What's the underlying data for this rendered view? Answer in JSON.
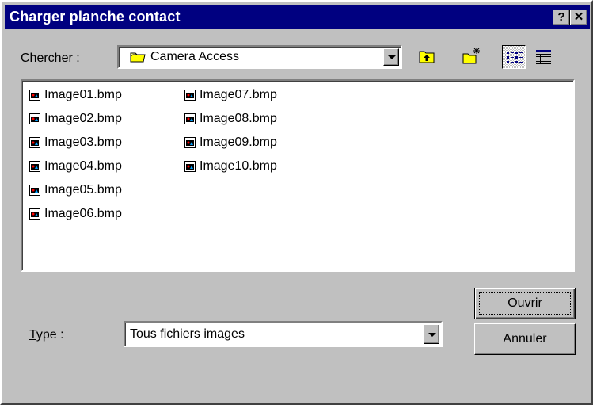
{
  "window": {
    "title": "Charger planche contact",
    "help_label": "?",
    "close_label": "✕"
  },
  "lookin": {
    "label_prefix": "Cherche",
    "label_accel": "r",
    "label_suffix": " :",
    "value": "Camera Access",
    "icon": "folder-icon"
  },
  "toolbar": {
    "buttons": [
      {
        "name": "up-folder-button",
        "icon": "up-folder-icon"
      },
      {
        "name": "new-folder-button",
        "icon": "new-folder-icon"
      },
      {
        "name": "list-view-button",
        "icon": "list-view-icon",
        "pressed": true
      },
      {
        "name": "details-view-button",
        "icon": "details-view-icon"
      }
    ]
  },
  "files": {
    "icon": "bitmap-file-icon",
    "items": [
      "Image01.bmp",
      "Image02.bmp",
      "Image03.bmp",
      "Image04.bmp",
      "Image05.bmp",
      "Image06.bmp",
      "Image07.bmp",
      "Image08.bmp",
      "Image09.bmp",
      "Image10.bmp"
    ]
  },
  "type": {
    "label_accel": "T",
    "label_rest": "ype  :",
    "value": "Tous fichiers images"
  },
  "buttons": {
    "open_accel": "O",
    "open_rest": "uvrir",
    "cancel": "Annuler"
  },
  "colors": {
    "title_bar": "#000080",
    "face": "#c0c0c0"
  }
}
